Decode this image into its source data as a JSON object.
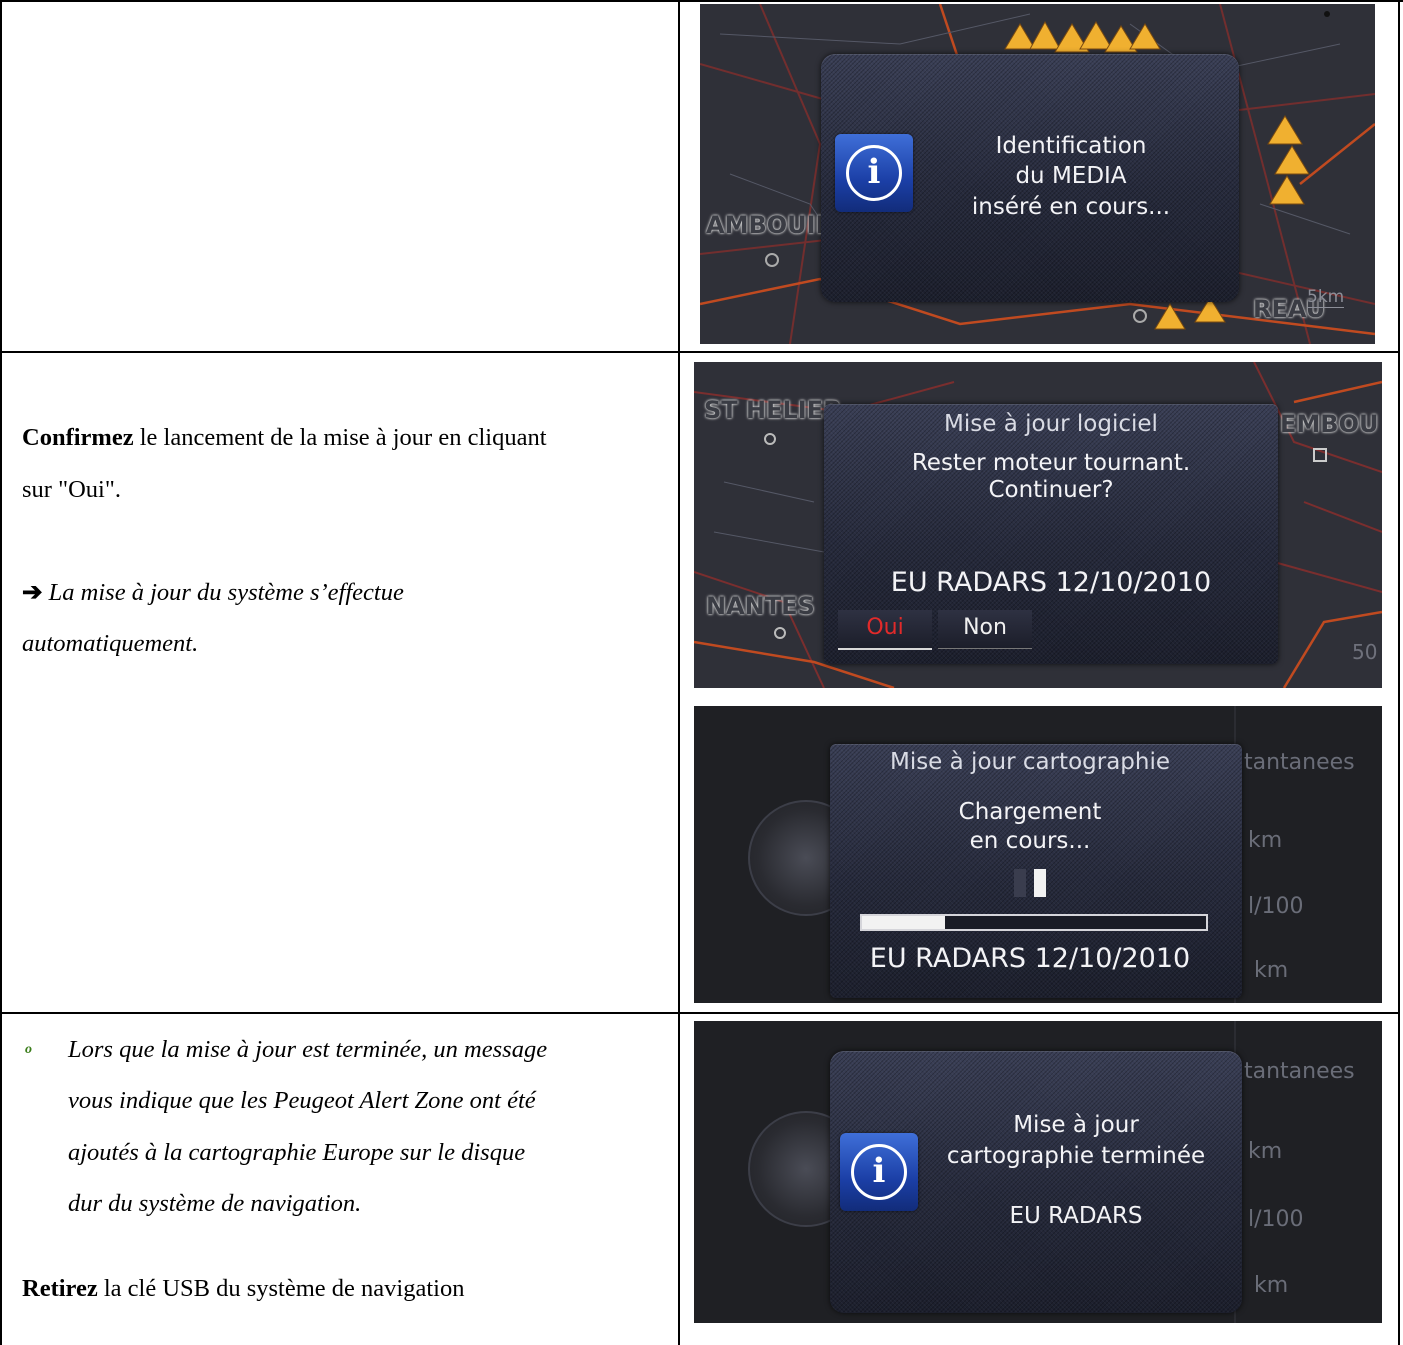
{
  "rows": {
    "row1": {
      "screen": {
        "map_label_left": "AMBOUIL",
        "map_label_right": "REAU",
        "scale": "5km",
        "message": [
          "Identification",
          "du MEDIA",
          "inséré en cours..."
        ]
      }
    },
    "row2": {
      "text": {
        "line1_bold": "Confirmez",
        "line1_rest": " le lancement de la mise à jour en cliquant",
        "line2": "sur \"Oui\".",
        "note_arrow": "➔",
        "note_line1": " La mise à jour du système s’effectue",
        "note_line2": "automatiquement."
      },
      "screen_confirm": {
        "map_label_tl": "ST HELIER",
        "map_label_tr": "EMBOU",
        "map_label_bl": "NANTES",
        "title": "Mise à jour logiciel",
        "message_line1": "Rester moteur tournant.",
        "message_line2": "Continuer?",
        "product": "EU RADARS  12/10/2010",
        "btn_yes": "Oui",
        "btn_no": "Non",
        "edge_number": "50"
      },
      "screen_loading": {
        "title": "Mise à jour cartographie",
        "status_line1": "Chargement",
        "status_line2": "en cours...",
        "progress_fraction": 0.24,
        "product": "EU RADARS  12/10/2010",
        "side_top": "tantanees",
        "side_km1": "km",
        "side_l100": "l/100",
        "side_km2": "km"
      }
    },
    "row3": {
      "text": {
        "bullet": "o",
        "para": [
          "Lors que la mise à jour est terminée, un message",
          "vous indique que les Peugeot Alert Zone ont été",
          "ajoutés à la cartographie Europe sur le disque",
          "dur du système de navigation."
        ],
        "retire_bold": "Retirez",
        "retire_rest": " la clé USB du système de navigation"
      },
      "screen_done": {
        "message_line1": "Mise à jour",
        "message_line2": "cartographie terminée",
        "product": "EU RADARS",
        "side_top": "tantanees",
        "side_km1": "km",
        "side_l100": "l/100",
        "side_km2": "km"
      }
    }
  }
}
